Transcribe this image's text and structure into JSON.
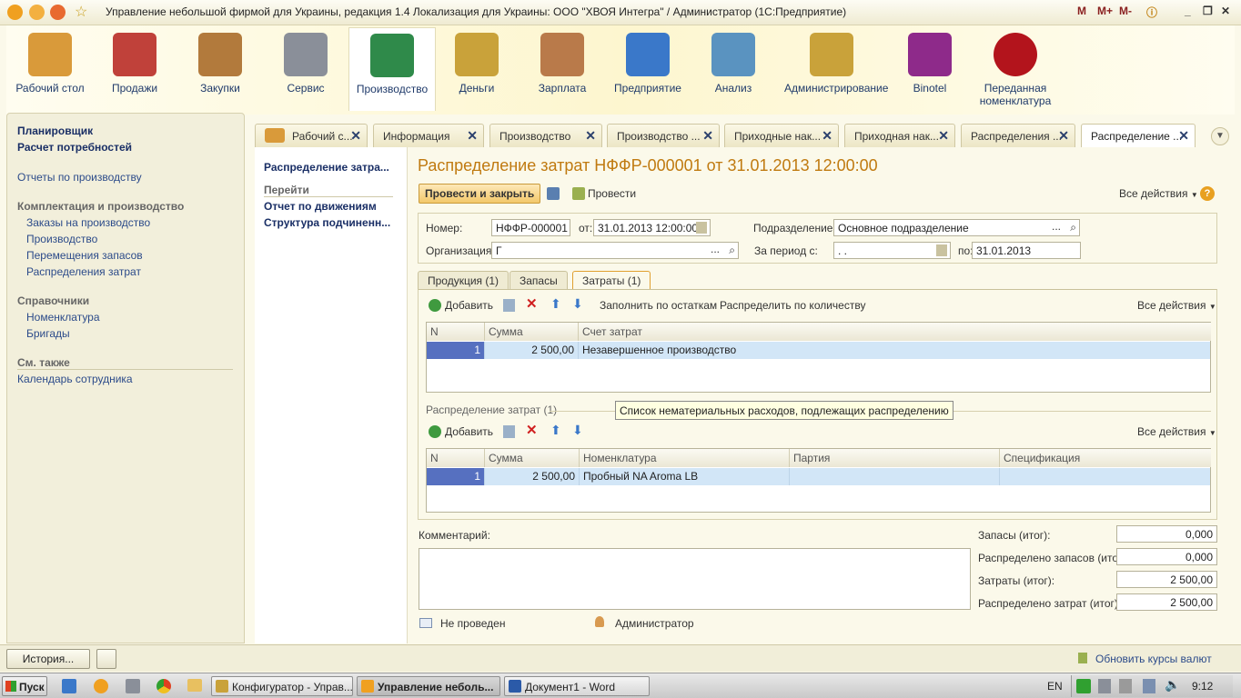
{
  "title_bar": {
    "title": "Управление небольшой фирмой для Украины, редакция 1.4 Локализация для Украины: ООО \"ХВОЯ Интегра\" / Администратор  (1С:Предприятие)",
    "mem_buttons": [
      "M",
      "M+",
      "M-"
    ]
  },
  "sections": [
    {
      "label": "Рабочий стол",
      "icon": "desk-icon",
      "color": "#d99a3a"
    },
    {
      "label": "Продажи",
      "icon": "basket-icon",
      "color": "#c0413a"
    },
    {
      "label": "Закупки",
      "icon": "boxes-icon",
      "color": "#b27a3c"
    },
    {
      "label": "Сервис",
      "icon": "tools-icon",
      "color": "#8a8f99"
    },
    {
      "label": "Производство",
      "icon": "factory-icon",
      "color": "#2f8a4a"
    },
    {
      "label": "Деньги",
      "icon": "coins-icon",
      "color": "#c9a23a"
    },
    {
      "label": "Зарплата",
      "icon": "person-icon",
      "color": "#b97a4a"
    },
    {
      "label": "Предприятие",
      "icon": "building-icon",
      "color": "#3a78c9"
    },
    {
      "label": "Анализ",
      "icon": "chart-icon",
      "color": "#5a93c0"
    },
    {
      "label": "Администрирование",
      "icon": "server-icon",
      "color": "#c9a23a"
    },
    {
      "label": "Binotel",
      "icon": "binotel-icon",
      "color": "#8e2a8a"
    },
    {
      "label": "Переданная номенклатура",
      "icon": "coffee-bean-icon",
      "color": "#b3141c"
    }
  ],
  "left_panel": {
    "top_links": [
      "Планировщик",
      "Расчет потребностей"
    ],
    "reports": "Отчеты по производству",
    "group1_title": "Комплектация и производство",
    "group1": [
      "Заказы на производство",
      "Производство",
      "Перемещения запасов",
      "Распределения затрат"
    ],
    "group2_title": "Справочники",
    "group2": [
      "Номенклатура",
      "Бригады"
    ],
    "group3_title": "См. также",
    "group3": [
      "Календарь сотрудника"
    ]
  },
  "tabs": [
    "Рабочий с...",
    "Информация",
    "Производство",
    "Производство ...",
    "Приходные нак...",
    "Приходная нак...",
    "Распределения ...",
    "Распределение ..."
  ],
  "nav": {
    "doc_link": "Распределение затра...",
    "goto": "Перейти",
    "links": [
      "Отчет по движениям",
      "Структура подчиненн..."
    ]
  },
  "form": {
    "heading": "Распределение затрат НФФР-000001 от 31.01.2013 12:00:00",
    "post_close": "Провести и закрыть",
    "post": "Провести",
    "all_actions": "Все действия",
    "number_label": "Номер:",
    "number": "НФФР-000001",
    "date_label": "от:",
    "date": "31.01.2013 12:00:00",
    "dept_label": "Подразделение:",
    "dept": "Основное подразделение",
    "org_label": "Организация:",
    "org": "Г",
    "period_label": "За период с:",
    "period_from": " .  .",
    "period_to_label": "по:",
    "period_to": "31.01.2013",
    "subtabs": [
      "Продукция (1)",
      "Запасы",
      "Затраты (1)"
    ],
    "toolbar1": {
      "add": "Добавить",
      "fill": "Заполнить по остаткам",
      "distribute": "Распределить по количеству",
      "all": "Все действия"
    },
    "grid1": {
      "columns": [
        "N",
        "Сумма",
        "Счет затрат"
      ],
      "rows": [
        [
          "1",
          "2 500,00",
          "Незавершенное производство"
        ]
      ]
    },
    "dist_title": "Распределение затрат (1)",
    "tooltip": "Список нематериальных расходов, подлежащих распределению",
    "toolbar2": {
      "add": "Добавить",
      "all": "Все действия"
    },
    "grid2": {
      "columns": [
        "N",
        "Сумма",
        "Номенклатура",
        "Партия",
        "Спецификация"
      ],
      "rows": [
        [
          "1",
          "2 500,00",
          "Пробный NA Aroma LB",
          "",
          ""
        ]
      ]
    },
    "comment_label": "Комментарий:",
    "totals": [
      {
        "label": "Запасы (итог):",
        "value": "0,000"
      },
      {
        "label": "Распределено запасов (итог):",
        "value": "0,000"
      },
      {
        "label": "Затраты (итог):",
        "value": "2 500,00"
      },
      {
        "label": "Распределено затрат (итог):",
        "value": "2 500,00"
      }
    ],
    "status": "Не проведен",
    "author": "Администратор"
  },
  "statusbar": {
    "history": "История...",
    "rates": "Обновить курсы валют"
  },
  "taskbar": {
    "start": "Пуск",
    "tasks": [
      "Конфигуратор - Управ...",
      "Управление неболь...",
      "Документ1 - Word"
    ],
    "lang": "EN",
    "time": "9:12"
  }
}
